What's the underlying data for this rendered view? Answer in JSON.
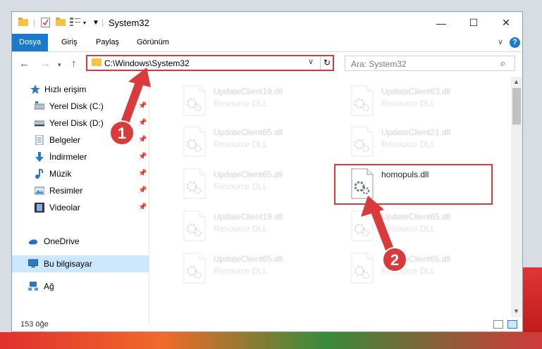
{
  "window": {
    "title": "System32",
    "controls": {
      "minimize": "—",
      "maximize": "☐",
      "close": "✕"
    }
  },
  "ribbon": {
    "tabs": [
      {
        "label": "Dosya",
        "active": true
      },
      {
        "label": "Giriş",
        "active": false
      },
      {
        "label": "Paylaş",
        "active": false
      },
      {
        "label": "Görünüm",
        "active": false
      }
    ],
    "help": "?"
  },
  "navigation": {
    "address": "C:\\Windows\\System32",
    "search_placeholder": "Ara: System32"
  },
  "sidebar": {
    "items": [
      {
        "label": "Hızlı erişim",
        "icon": "star-icon",
        "pinned": false
      },
      {
        "label": "Yerel Disk (C:)",
        "icon": "drive-icon",
        "pinned": true
      },
      {
        "label": "Yerel Disk (D:)",
        "icon": "drive-icon",
        "pinned": true
      },
      {
        "label": "Belgeler",
        "icon": "documents-icon",
        "pinned": true
      },
      {
        "label": "İndirmeler",
        "icon": "download-icon",
        "pinned": true
      },
      {
        "label": "Müzik",
        "icon": "music-icon",
        "pinned": true
      },
      {
        "label": "Resimler",
        "icon": "pictures-icon",
        "pinned": true
      },
      {
        "label": "Videolar",
        "icon": "videos-icon",
        "pinned": true
      },
      {
        "label": "OneDrive",
        "icon": "cloud-icon",
        "pinned": false
      },
      {
        "label": "Bu bilgisayar",
        "icon": "computer-icon",
        "pinned": false
      },
      {
        "label": "Ağ",
        "icon": "network-icon",
        "pinned": false
      }
    ]
  },
  "files": [
    {
      "name": "UpdateClient19.dll",
      "type": "Resource DLL",
      "faded": true
    },
    {
      "name": "UpdateClient63.dll",
      "type": "Resource DLL",
      "faded": true
    },
    {
      "name": "UpdateClient65.dll",
      "type": "Resource DLL",
      "faded": true
    },
    {
      "name": "UpdateClient21.dll",
      "type": "Resource DLL",
      "faded": true
    },
    {
      "name": "UpdateClient65.dll",
      "type": "Resource DLL",
      "faded": true
    },
    {
      "name": "homopuls.dll",
      "type": "",
      "faded": false
    },
    {
      "name": "UpdateClient19.dll",
      "type": "Resource DLL",
      "faded": true
    },
    {
      "name": "UpdateClient65.dll",
      "type": "Resource DLL",
      "faded": true
    },
    {
      "name": "UpdateClient65.dll",
      "type": "Resource DLL",
      "faded": true
    },
    {
      "name": "UpdateClient65.dll",
      "type": "Resource DLL",
      "faded": true
    }
  ],
  "status": {
    "count": "153 öğe"
  },
  "annotations": [
    {
      "number": "1"
    },
    {
      "number": "2"
    }
  ],
  "colors": {
    "accent": "#1979ca",
    "highlight": "#d43a3a",
    "selected": "#cce8ff"
  }
}
